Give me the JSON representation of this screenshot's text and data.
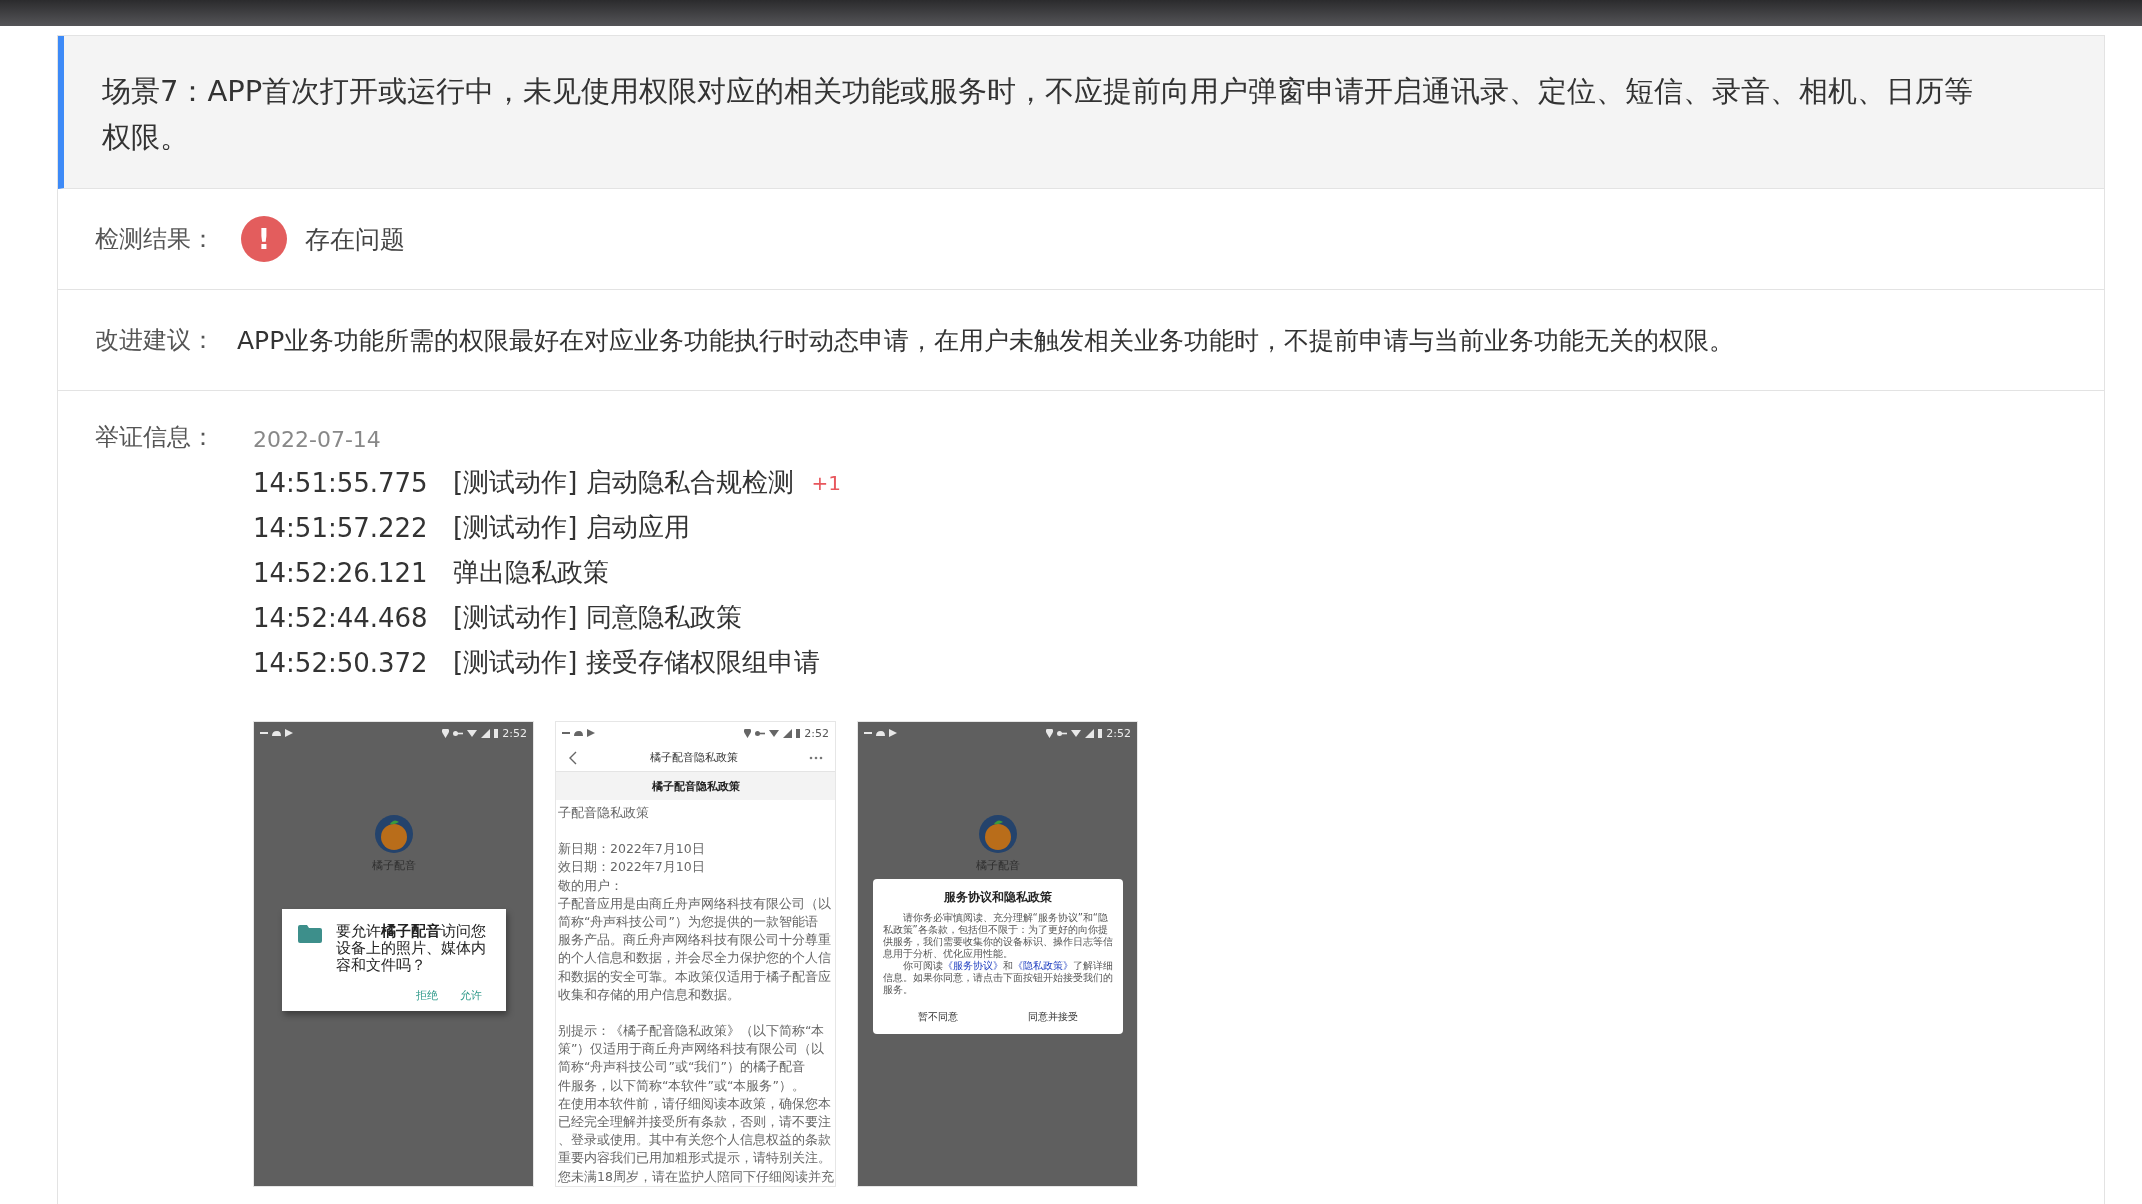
{
  "scenario": {
    "title": "场景7：APP首次打开或运行中，未见使用权限对应的相关功能或服务时，不应提前向用户弹窗申请开启通讯录、定位、短信、录音、相机、日历等权限。"
  },
  "result": {
    "label": "检测结果：",
    "icon": "!",
    "status": "存在问题"
  },
  "suggestion": {
    "label": "改进建议：",
    "text": "APP业务功能所需的权限最好在对应业务功能执行时动态申请，在用户未触发相关业务功能时，不提前申请与当前业务功能无关的权限。"
  },
  "evidence": {
    "label": "举证信息：",
    "date": "2022-07-14",
    "events": [
      {
        "time": "14:51:55.775",
        "action": "[测试动作] 启动隐私合规检测",
        "badge": "+1"
      },
      {
        "time": "14:51:57.222",
        "action": "[测试动作] 启动应用"
      },
      {
        "time": "14:52:26.121",
        "action": "弹出隐私政策"
      },
      {
        "time": "14:52:44.468",
        "action": "[测试动作] 同意隐私政策"
      },
      {
        "time": "14:52:50.372",
        "action": "[测试动作] 接受存储权限组申请"
      }
    ],
    "screenshots": [
      {
        "kind": "permission_dialog",
        "status_time": "2:52",
        "app_name": "橘子配音",
        "message": "要允许**橘子配音**访问您设备上的照片、媒体内容和文件吗？",
        "buttons": [
          "拒绝",
          "允许"
        ]
      },
      {
        "kind": "policy_page",
        "status_time": "2:52",
        "nav_title": "橘子配音隐私政策",
        "heading": "橘子配音隐私政策",
        "lines": [
          "子配音隐私政策",
          "新日期：2022年7月10日",
          "效日期：2022年7月10日",
          "敬的用户：",
          "子配音应用是由商丘舟声网络科技有限公司（以",
          "简称“舟声科技公司”）为您提供的一款智能语",
          "服务产品。商丘舟声网络科技有限公司十分尊重",
          "的个人信息和数据，并会尽全力保护您的个人信",
          "和数据的安全可靠。本政策仅适用于橘子配音应",
          "收集和存储的用户信息和数据。",
          "别提示：《橘子配音隐私政策》（以下简称“本",
          "策”）仅适用于商丘舟声网络科技有限公司（以",
          "简称“舟声科技公司”或“我们”）的橘子配音",
          "件服务，以下简称“本软件”或“本服务”）。",
          "在使用本软件前，请仔细阅读本政策，确保您本",
          "已经完全理解并接受所有条款，否则，请不要注",
          "、登录或使用。其中有关您个人信息权益的条款",
          "重要内容我们已用加粗形式提示，请特别关注。",
          "您未满18周岁，请在监护人陪同下仔细阅读并充"
        ]
      },
      {
        "kind": "consent_dialog",
        "status_time": "2:52",
        "app_name": "橘子配音",
        "title": "服务协议和隐私政策",
        "paragraph": "请你务必审慎阅读、充分理解“服务协议”和“隐私政策”各条款，包括但不限于：为了更好的向你提供服务，我们需要收集你的设备标识、操作日志等信息用于分析、优化应用性能。",
        "read_parts": [
          {
            "kind": "text",
            "text": "你可阅读"
          },
          {
            "kind": "link",
            "text": "《服务协议》"
          },
          {
            "kind": "text",
            "text": "和"
          },
          {
            "kind": "link",
            "text": "《隐私政策》"
          },
          {
            "kind": "text",
            "text": "了解详细信息。如果你同意，请点击下面按钮开始接受我们的服务。"
          }
        ],
        "buttons": [
          "暂不同意",
          "同意并接受"
        ]
      }
    ]
  }
}
